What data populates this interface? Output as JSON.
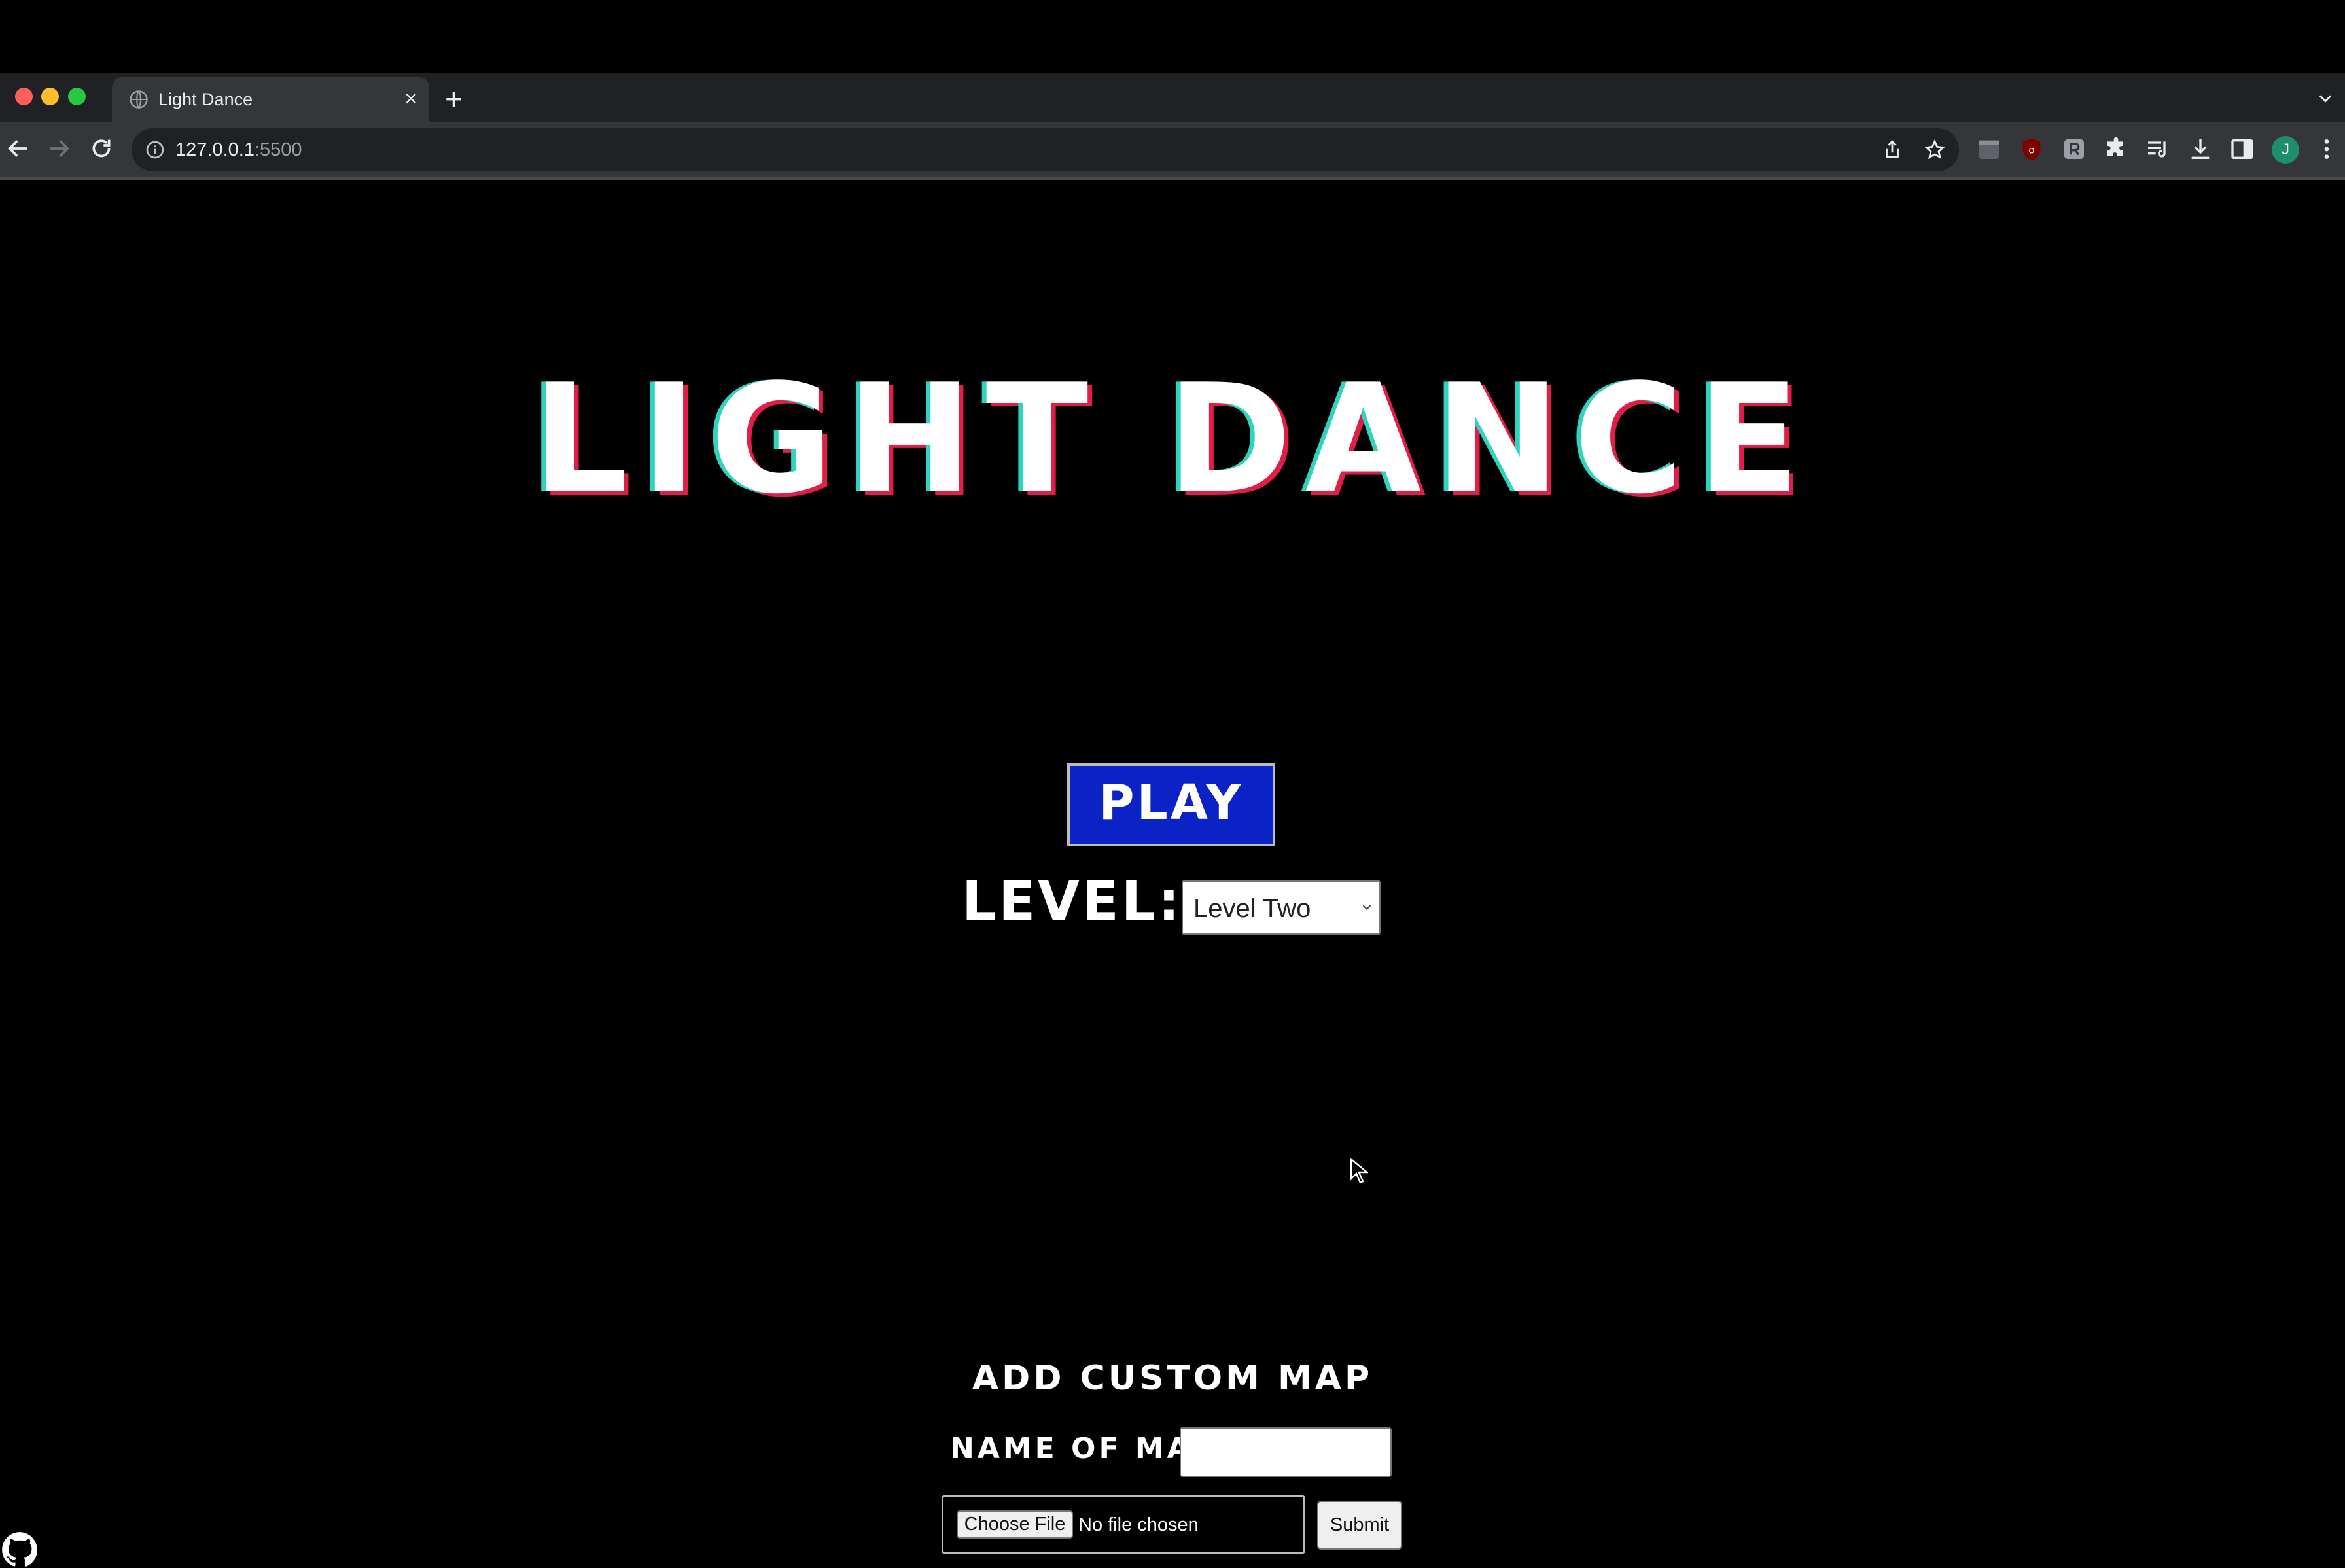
{
  "browser": {
    "tab_title": "Light Dance",
    "new_tab_symbol": "+",
    "close_tab_symbol": "×",
    "url_host": "127.0.0.1",
    "url_port": ":5500",
    "avatar_initial": "J",
    "icons": [
      "back-icon",
      "forward-icon",
      "reload-icon",
      "info-icon",
      "share-icon",
      "bookmark-star-icon",
      "extension-puzzle-icon",
      "media-queue-icon",
      "download-icon",
      "side-panel-icon",
      "more-menu-icon"
    ]
  },
  "page": {
    "title": "LIGHT DANCE",
    "play_label": "PLAY",
    "level_label": "LEVEL:",
    "level_selected": "Level  Two",
    "custom_heading": "ADD CUSTOM MAP",
    "name_label": "NAME OF MAP:",
    "name_value": "",
    "choose_file_label": "Choose File",
    "no_file_text": "No file chosen",
    "submit_label": "Submit"
  },
  "colors": {
    "background": "#000000",
    "play_button": "#0a22c6",
    "title_shadow_cyan": "#2dd4bf",
    "title_shadow_red": "#e11d48"
  }
}
